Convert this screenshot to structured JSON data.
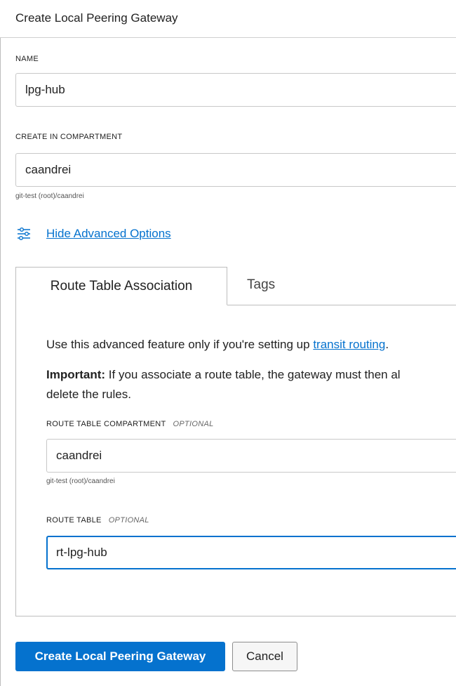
{
  "dialog": {
    "title": "Create Local Peering Gateway"
  },
  "name_field": {
    "label": "NAME",
    "value": "lpg-hub"
  },
  "compartment_field": {
    "label": "CREATE IN COMPARTMENT",
    "value": "caandrei",
    "hint": "git-test (root)/caandrei"
  },
  "advanced": {
    "link_text": "Hide Advanced Options",
    "icon": "sliders-icon"
  },
  "tabs": [
    {
      "label": "Route Table Association",
      "active": true
    },
    {
      "label": "Tags",
      "active": false
    }
  ],
  "route_assoc": {
    "intro_prefix": "Use this advanced feature only if you're setting up ",
    "intro_link": "transit routing",
    "intro_suffix": ".",
    "important_label": "Important:",
    "important_text": " If you associate a route table, the gateway must then al",
    "important_text_line2": "delete the rules.",
    "rt_compartment": {
      "label": "ROUTE TABLE COMPARTMENT",
      "optional": "OPTIONAL",
      "value": "caandrei",
      "hint": "git-test (root)/caandrei"
    },
    "route_table": {
      "label": "ROUTE TABLE",
      "optional": "OPTIONAL",
      "value": "rt-lpg-hub"
    }
  },
  "footer": {
    "create_label": "Create Local Peering Gateway",
    "cancel_label": "Cancel"
  },
  "colors": {
    "accent": "#0572ce",
    "border": "#bdbdbd"
  }
}
